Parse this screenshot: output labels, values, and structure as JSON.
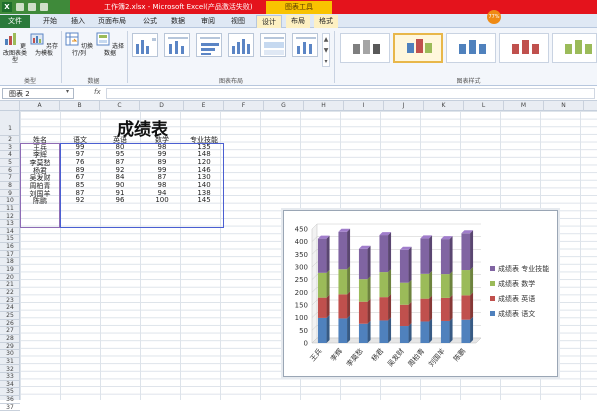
{
  "window": {
    "title": "工作簿2.xlsx - Microsoft Excel(产品激活失败)",
    "context_label": "图表工具"
  },
  "tabs": [
    {
      "label": "文件"
    },
    {
      "label": "开始"
    },
    {
      "label": "插入"
    },
    {
      "label": "页面布局"
    },
    {
      "label": "公式"
    },
    {
      "label": "数据"
    },
    {
      "label": "审阅"
    },
    {
      "label": "视图"
    },
    {
      "label": "设计"
    },
    {
      "label": "布局"
    },
    {
      "label": "格式"
    }
  ],
  "badge": "77%",
  "ribbon": {
    "change_type": "更改图表类型",
    "save_template": "另存为模板",
    "switch_row_col": "切换行/列",
    "select_data": "选择数据",
    "group_type": "类型",
    "group_data": "数据",
    "group_layout": "图表布局",
    "group_style": "图表样式"
  },
  "formula_bar": {
    "name_box": "图表 2",
    "fx": "fx",
    "value": ""
  },
  "columns": [
    "A",
    "B",
    "C",
    "D",
    "E",
    "F",
    "G",
    "H",
    "I",
    "J",
    "K",
    "L",
    "M",
    "N"
  ],
  "rows": [
    "1",
    "2",
    "3",
    "4",
    "5",
    "6",
    "7",
    "8",
    "9",
    "10",
    "11",
    "12",
    "13",
    "14",
    "15",
    "16",
    "17",
    "18",
    "19",
    "20",
    "21",
    "22",
    "23",
    "24",
    "25",
    "26",
    "27",
    "28",
    "29",
    "30",
    "31",
    "32",
    "33",
    "34",
    "35",
    "36",
    "37"
  ],
  "sheet": {
    "title": "成绩表",
    "headers": [
      "姓名",
      "语文",
      "英语",
      "数学",
      "专业技能"
    ],
    "rows": [
      [
        "王兵",
        "99",
        "80",
        "98",
        "135"
      ],
      [
        "李辉",
        "97",
        "95",
        "99",
        "148"
      ],
      [
        "李莫愁",
        "76",
        "87",
        "89",
        "120"
      ],
      [
        "杨君",
        "89",
        "92",
        "99",
        "146"
      ],
      [
        "吴发财",
        "67",
        "84",
        "87",
        "130"
      ],
      [
        "周柏青",
        "85",
        "90",
        "98",
        "140"
      ],
      [
        "刘国羊",
        "87",
        "91",
        "94",
        "138"
      ],
      [
        "陈鹏",
        "92",
        "96",
        "100",
        "145"
      ]
    ]
  },
  "chart_data": {
    "type": "bar",
    "stacked": true,
    "style_3d": true,
    "categories": [
      "王兵",
      "李辉",
      "李莫愁",
      "杨君",
      "吴发财",
      "周柏青",
      "刘国羊",
      "陈鹏"
    ],
    "series": [
      {
        "name": "成绩表 语文",
        "values": [
          99,
          97,
          76,
          89,
          67,
          85,
          87,
          92
        ],
        "color": "#4f81bd"
      },
      {
        "name": "成绩表 英语",
        "values": [
          80,
          95,
          87,
          92,
          84,
          90,
          91,
          96
        ],
        "color": "#c0504d"
      },
      {
        "name": "成绩表 数学",
        "values": [
          98,
          99,
          89,
          99,
          87,
          98,
          94,
          100
        ],
        "color": "#9bbb59"
      },
      {
        "name": "成绩表 专业技能",
        "values": [
          135,
          148,
          120,
          146,
          130,
          140,
          138,
          145
        ],
        "color": "#8064a2"
      }
    ],
    "yticks": [
      "0",
      "50",
      "100",
      "150",
      "200",
      "250",
      "300",
      "350",
      "400",
      "450"
    ],
    "ylim": [
      0,
      450
    ],
    "grid": true,
    "legend": "right"
  }
}
